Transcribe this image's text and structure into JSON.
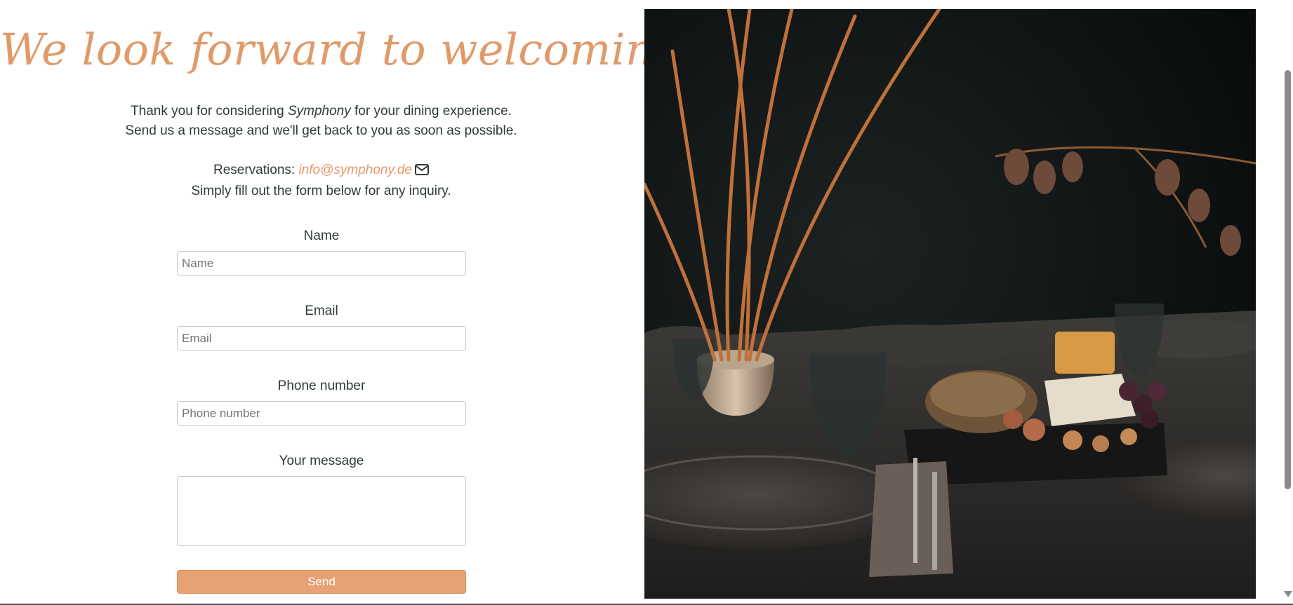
{
  "headline": "We look forward to welcoming you...",
  "intro": {
    "line1_before": "Thank you for considering ",
    "brand": "Symphony",
    "line1_after": " for your dining experience.",
    "line2": "Send us a message and we'll get back to you as soon as possible.",
    "reservations_label": "Reservations: ",
    "reservations_email": "info@symphony.de",
    "line4": "Simply fill out the form below for any inquiry."
  },
  "form": {
    "name_label": "Name",
    "name_placeholder": "Name",
    "email_label": "Email",
    "email_placeholder": "Email",
    "phone_label": "Phone number",
    "phone_placeholder": "Phone number",
    "message_label": "Your message",
    "message_value": "",
    "send_label": "Send"
  },
  "icons": {
    "mail": "envelope-icon"
  },
  "colors": {
    "accent": "#e39a69",
    "button": "#e8a173",
    "text": "#2f3a3a"
  }
}
